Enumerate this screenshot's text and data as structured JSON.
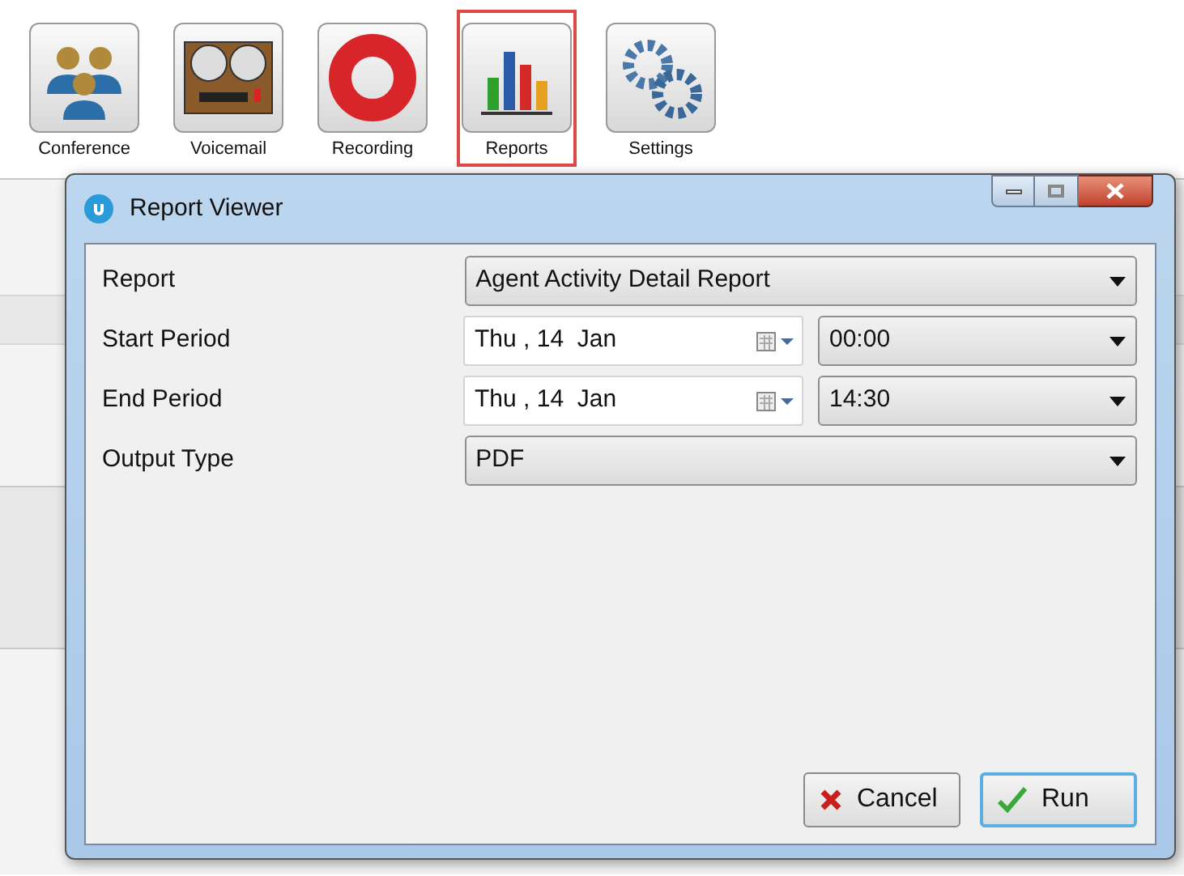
{
  "toolbar": {
    "buttons": [
      {
        "label": "Conference",
        "kind": "conference",
        "selected": false
      },
      {
        "label": "Voicemail",
        "kind": "voicemail",
        "selected": false
      },
      {
        "label": "Recording",
        "kind": "recording",
        "selected": false
      },
      {
        "label": "Reports",
        "kind": "reports",
        "selected": true
      },
      {
        "label": "Settings",
        "kind": "settings",
        "selected": false
      }
    ]
  },
  "dialog": {
    "title": "Report Viewer",
    "fields": [
      {
        "label": "Report",
        "kind": "select",
        "value": "Agent Activity Detail Report"
      },
      {
        "label": "Start Period",
        "kind": "datetime",
        "date": "Thu , 14  Jan",
        "time": "00:00"
      },
      {
        "label": "End Period",
        "kind": "datetime",
        "date": "Thu , 14  Jan",
        "time": "14:30"
      },
      {
        "label": "Output Type",
        "kind": "select",
        "value": "PDF"
      }
    ],
    "buttons": [
      {
        "label": "Cancel",
        "kind": "cancel"
      },
      {
        "label": "Run",
        "kind": "run"
      }
    ]
  }
}
